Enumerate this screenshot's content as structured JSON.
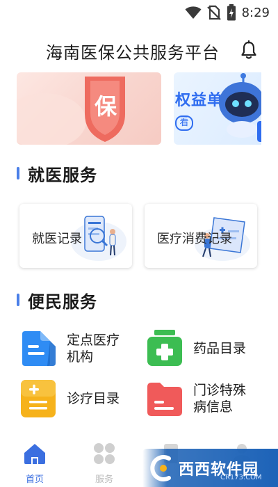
{
  "status_bar": {
    "time": "8:29",
    "icons": [
      "wifi-icon",
      "no-sim-icon",
      "battery-charging-icon"
    ]
  },
  "header": {
    "title": "海南医保公共服务平台",
    "icon": "bell-icon"
  },
  "banner": {
    "left_badge": "保",
    "right_text": "权益单",
    "right_sub": "看"
  },
  "medical_services": {
    "title": "就医服务",
    "cards": [
      {
        "label": "就医记录",
        "icon": "phone-magnifier-illustration"
      },
      {
        "label": "医疗消费记录",
        "icon": "medical-board-illustration"
      }
    ]
  },
  "convenience_services": {
    "title": "便民服务",
    "items": [
      {
        "label_lines": [
          "定点医疗",
          "机构"
        ],
        "icon": "document-icon",
        "color": "#2f8cf4"
      },
      {
        "label_lines": [
          "药品目录"
        ],
        "icon": "medical-kit-icon",
        "color": "#3cbd52"
      },
      {
        "label_lines": [
          "诊疗目录"
        ],
        "icon": "calculator-icon",
        "color": "#f6b21b"
      },
      {
        "label_lines": [
          "门诊特殊",
          "病信息"
        ],
        "icon": "folder-icon",
        "color": "#f05a5a"
      }
    ]
  },
  "bottom_nav": {
    "items": [
      {
        "label": "首页",
        "icon": "home-icon",
        "active": true
      },
      {
        "label": "服务",
        "icon": "grid-icon",
        "active": false
      }
    ],
    "accent_color": "#3b6fe0"
  },
  "watermark": {
    "text": "西西软件园",
    "sub": "CR173.COM"
  }
}
